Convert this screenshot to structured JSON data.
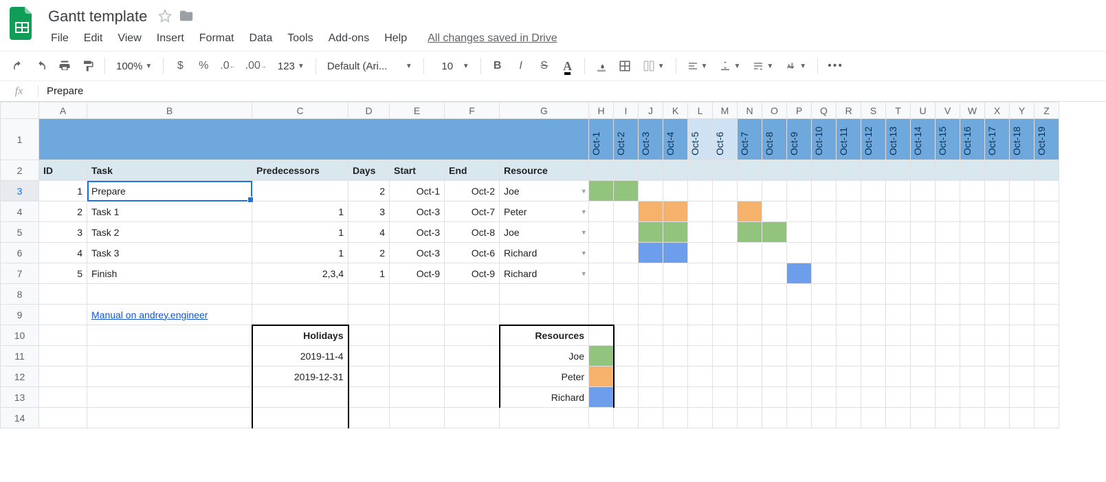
{
  "app": {
    "title": "Gantt template",
    "save_status": "All changes saved in Drive"
  },
  "menu": [
    "File",
    "Edit",
    "View",
    "Insert",
    "Format",
    "Data",
    "Tools",
    "Add-ons",
    "Help"
  ],
  "toolbar": {
    "zoom": "100%",
    "currency": "$",
    "percent": "%",
    "dec_less": ".0",
    "dec_more": ".00",
    "numfmt": "123",
    "font": "Default (Ari...",
    "size": "10"
  },
  "formula": {
    "label": "fx",
    "value": "Prepare"
  },
  "columns": [
    "A",
    "B",
    "C",
    "D",
    "E",
    "F",
    "G",
    "H",
    "I",
    "J",
    "K",
    "L",
    "M",
    "N",
    "O",
    "P",
    "Q",
    "R",
    "S",
    "T",
    "U",
    "V",
    "W",
    "X",
    "Y",
    "Z"
  ],
  "col_widths": {
    "A": 70,
    "B": 240,
    "C": 140,
    "D": 60,
    "E": 80,
    "F": 80,
    "G": 130,
    "narrow": 36
  },
  "row_numbers": [
    1,
    2,
    3,
    4,
    5,
    6,
    7,
    8,
    9,
    10,
    11,
    12,
    13,
    14
  ],
  "dates": [
    "Oct-1",
    "Oct-2",
    "Oct-3",
    "Oct-4",
    "Oct-5",
    "Oct-6",
    "Oct-7",
    "Oct-8",
    "Oct-9",
    "Oct-10",
    "Oct-11",
    "Oct-12",
    "Oct-13",
    "Oct-14",
    "Oct-15",
    "Oct-16",
    "Oct-17",
    "Oct-18",
    "Oct-19"
  ],
  "weekend_cols": [
    4,
    5
  ],
  "headers2": {
    "A": "ID",
    "B": "Task",
    "C": "Predecessors",
    "D": "Days",
    "E": "Start",
    "F": "End",
    "G": "Resource"
  },
  "tasks": [
    {
      "id": 1,
      "task": "Prepare",
      "pred": "",
      "days": 2,
      "start": "Oct-1",
      "end": "Oct-2",
      "res": "Joe",
      "bars": {
        "0": "g-green",
        "1": "g-green"
      }
    },
    {
      "id": 2,
      "task": "Task 1",
      "pred": "1",
      "days": 3,
      "start": "Oct-3",
      "end": "Oct-7",
      "res": "Peter",
      "bars": {
        "2": "g-orange",
        "3": "g-orange",
        "6": "g-orange"
      }
    },
    {
      "id": 3,
      "task": "Task 2",
      "pred": "1",
      "days": 4,
      "start": "Oct-3",
      "end": "Oct-8",
      "res": "Joe",
      "bars": {
        "2": "g-green",
        "3": "g-green",
        "6": "g-green",
        "7": "g-green"
      }
    },
    {
      "id": 4,
      "task": "Task 3",
      "pred": "1",
      "days": 2,
      "start": "Oct-3",
      "end": "Oct-6",
      "res": "Richard",
      "bars": {
        "2": "g-blue",
        "3": "g-blue"
      }
    },
    {
      "id": 5,
      "task": "Finish",
      "pred": "2,3,4",
      "days": 1,
      "start": "Oct-9",
      "end": "Oct-9",
      "res": "Richard",
      "bars": {
        "8": "g-blue"
      }
    }
  ],
  "link_row": {
    "text": "Manual on andrey.engineer"
  },
  "holidays": {
    "title": "Holidays",
    "rows": [
      "2019-11-4",
      "2019-12-31"
    ]
  },
  "resources": {
    "title": "Resources",
    "rows": [
      {
        "name": "Joe",
        "color": "g-green"
      },
      {
        "name": "Peter",
        "color": "g-orange"
      },
      {
        "name": "Richard",
        "color": "g-blue"
      }
    ]
  },
  "selected": {
    "row": 3,
    "col": "B"
  },
  "chart_data": {
    "type": "table",
    "title": "Gantt template",
    "columns": [
      "ID",
      "Task",
      "Predecessors",
      "Days",
      "Start",
      "End",
      "Resource"
    ],
    "rows": [
      [
        1,
        "Prepare",
        "",
        2,
        "Oct-1",
        "Oct-2",
        "Joe"
      ],
      [
        2,
        "Task 1",
        "1",
        3,
        "Oct-3",
        "Oct-7",
        "Peter"
      ],
      [
        3,
        "Task 2",
        "1",
        4,
        "Oct-3",
        "Oct-8",
        "Joe"
      ],
      [
        4,
        "Task 3",
        "1",
        2,
        "Oct-3",
        "Oct-6",
        "Richard"
      ],
      [
        5,
        "Finish",
        "2,3,4",
        1,
        "Oct-9",
        "Oct-9",
        "Richard"
      ]
    ],
    "holidays": [
      "2019-11-4",
      "2019-12-31"
    ],
    "resources": [
      "Joe",
      "Peter",
      "Richard"
    ],
    "date_range": [
      "Oct-1",
      "Oct-19"
    ]
  }
}
